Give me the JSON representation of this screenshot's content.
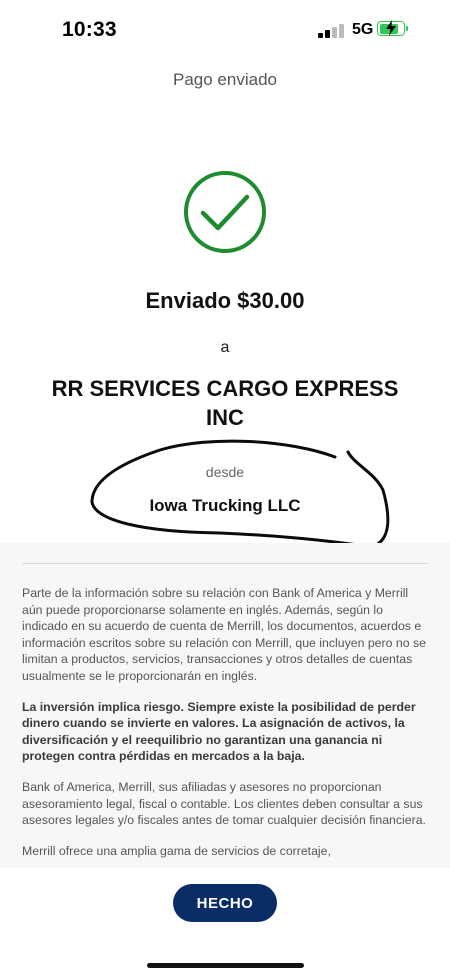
{
  "status_bar": {
    "time": "10:33",
    "network": "5G"
  },
  "header": {
    "title": "Pago enviado"
  },
  "confirmation": {
    "icon": "checkmark-circle-icon",
    "sent_amount": "Enviado $30.00",
    "to_label": "a",
    "recipient": "RR SERVICES CARGO EXPRESS INC",
    "from_label": "desde",
    "from_account": "Iowa Trucking LLC"
  },
  "disclosure": {
    "paragraphs": [
      "Parte de la información sobre su relación con Bank of America y Merrill aún puede proporcionarse solamente en inglés. Además, según lo indicado en su acuerdo de cuenta de Merrill, los documentos, acuerdos e información escritos sobre su relación con Merrill, que incluyen pero no se limitan a productos, servicios, transacciones y otros detalles de cuentas usualmente se le proporcionarán en inglés.",
      "La inversión implica riesgo. Siempre existe la posibilidad de perder dinero cuando se invierte en valores. La asignación de activos, la diversificación y el reequilibrio no garantizan una ganancia ni protegen contra pérdidas en mercados a la baja.",
      "Bank of America, Merrill, sus afiliadas y asesores no proporcionan asesoramiento legal, fiscal o contable. Los clientes deben consultar a sus asesores legales y/o fiscales antes de tomar cualquier decisión financiera.",
      "Merrill ofrece una amplia gama de servicios de corretaje,"
    ]
  },
  "footer": {
    "done_label": "HECHO"
  },
  "colors": {
    "success_green": "#1e8c2e",
    "button_navy": "#0a2d66",
    "battery_green": "#34c759"
  }
}
